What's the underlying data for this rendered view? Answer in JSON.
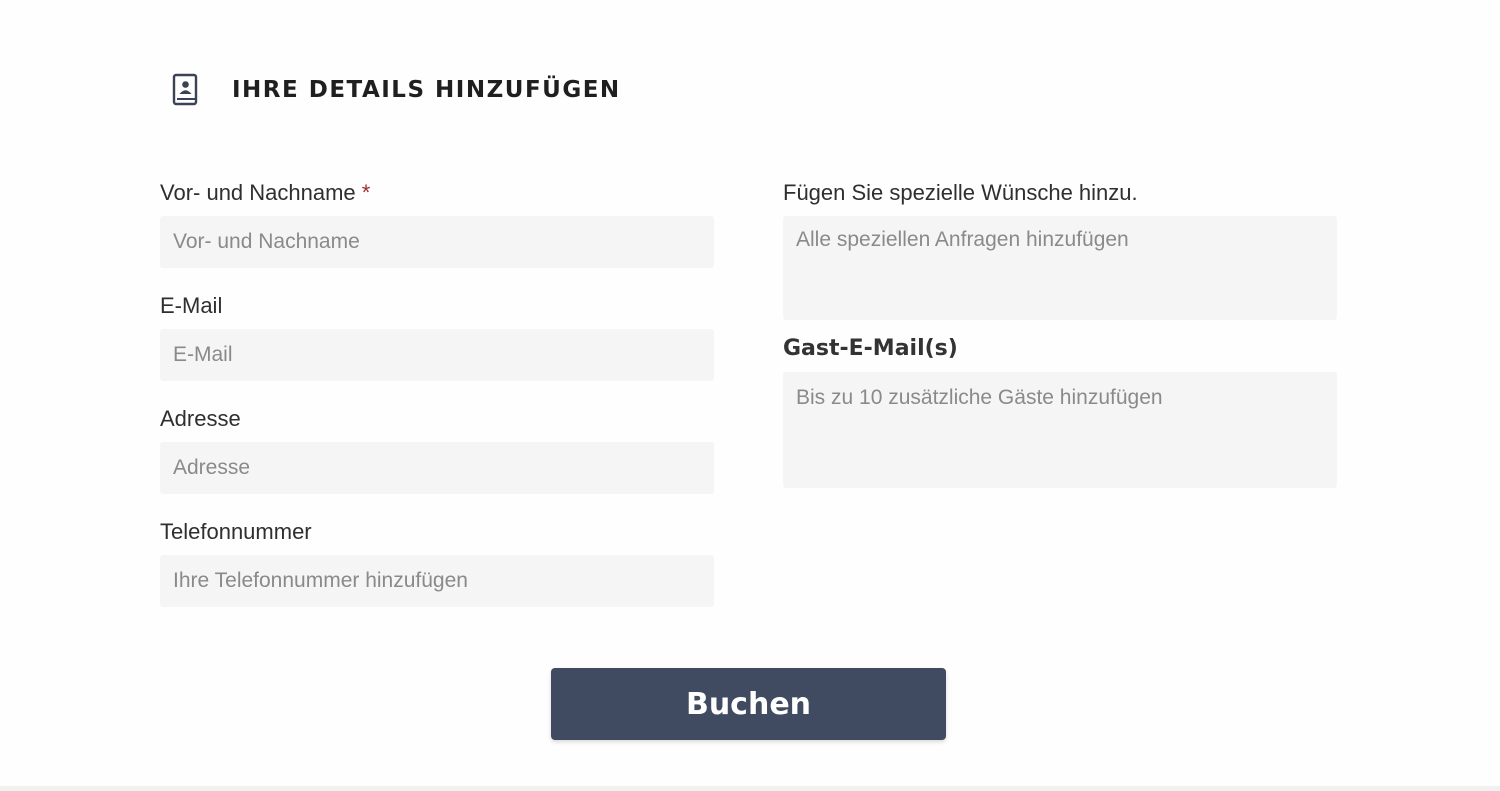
{
  "section": {
    "title": "IHRE DETAILS HINZUFÜGEN",
    "icon": "contact-book-icon"
  },
  "form": {
    "name": {
      "label": "Vor- und Nachname",
      "required_marker": "*",
      "placeholder": "Vor- und Nachname",
      "value": ""
    },
    "email": {
      "label": "E-Mail",
      "placeholder": "E-Mail",
      "value": ""
    },
    "address": {
      "label": "Adresse",
      "placeholder": "Adresse",
      "value": ""
    },
    "phone": {
      "label": "Telefonnummer",
      "placeholder": "Ihre Telefonnummer hinzufügen",
      "value": ""
    },
    "special_requests": {
      "label": "Fügen Sie spezielle Wünsche hinzu.",
      "placeholder": "Alle speziellen Anfragen hinzufügen",
      "value": ""
    },
    "guest_emails": {
      "label": "Gast-E-Mail(s)",
      "placeholder": "Bis zu 10 zusätzliche Gäste hinzufügen",
      "value": ""
    },
    "submit_label": "Buchen"
  },
  "colors": {
    "button_bg": "#404a60",
    "input_bg": "#f5f5f5",
    "required": "#9b2c2c"
  }
}
